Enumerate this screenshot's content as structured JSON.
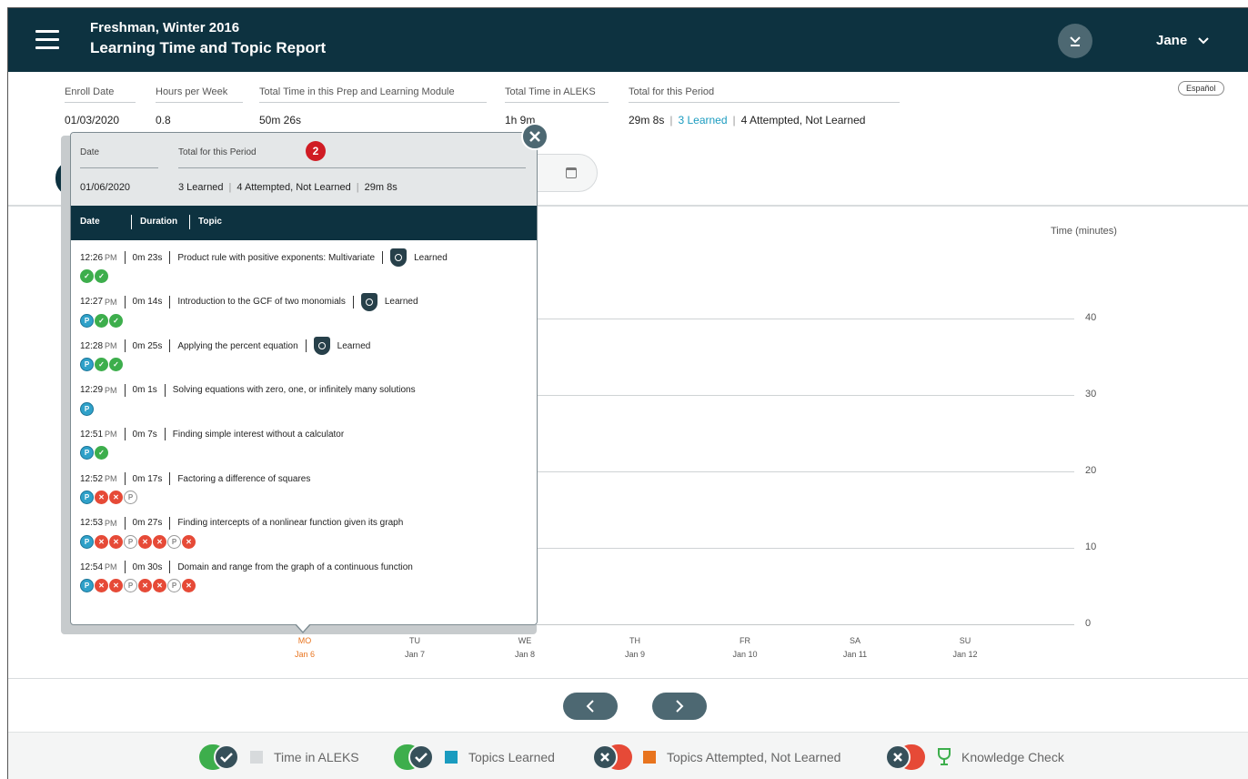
{
  "header": {
    "subtitle": "Freshman, Winter 2016",
    "title": "Learning Time and Topic Report",
    "user": "Jane"
  },
  "summary": {
    "enroll_date_label": "Enroll Date",
    "enroll_date": "01/03/2020",
    "hours_label": "Hours per Week",
    "hours": "0.8",
    "total_prep_label": "Total Time in this Prep and Learning Module",
    "total_prep": "50m 26s",
    "total_aleks_label": "Total Time in ALEKS",
    "total_aleks": "1h 9m",
    "period_label": "Total for this Period",
    "period_time": "29m 8s",
    "period_learned": "3 Learned",
    "period_attempted": "4 Attempted, Not Learned",
    "espanol": "Español"
  },
  "popup": {
    "date_label": "Date",
    "total_label": "Total for this Period",
    "badge": "2",
    "date": "01/06/2020",
    "learned": "3 Learned",
    "attempted": "4 Attempted, Not Learned",
    "time": "29m 8s",
    "col_date": "Date",
    "col_duration": "Duration",
    "col_topic": "Topic",
    "rows": [
      {
        "time": "12:26",
        "ampm": "PM",
        "duration": "0m 23s",
        "topic": "Product rule with positive exponents: Multivariate",
        "status": "Learned",
        "icons": [
          "ok",
          "ok"
        ]
      },
      {
        "time": "12:27",
        "ampm": "PM",
        "duration": "0m 14s",
        "topic": "Introduction to the GCF of two monomials",
        "status": "Learned",
        "icons": [
          "p",
          "ok",
          "ok"
        ]
      },
      {
        "time": "12:28",
        "ampm": "PM",
        "duration": "0m 25s",
        "topic": "Applying the percent equation",
        "status": "Learned",
        "icons": [
          "p",
          "ok",
          "ok"
        ]
      },
      {
        "time": "12:29",
        "ampm": "PM",
        "duration": "0m 1s",
        "topic": "Solving equations with zero, one, or infinitely many solutions",
        "status": "",
        "icons": [
          "p"
        ]
      },
      {
        "time": "12:51",
        "ampm": "PM",
        "duration": "0m 7s",
        "topic": "Finding simple interest without a calculator",
        "status": "",
        "icons": [
          "p",
          "ok"
        ]
      },
      {
        "time": "12:52",
        "ampm": "PM",
        "duration": "0m 17s",
        "topic": "Factoring a difference of squares",
        "status": "",
        "icons": [
          "p",
          "x",
          "x",
          "pg"
        ]
      },
      {
        "time": "12:53",
        "ampm": "PM",
        "duration": "0m 27s",
        "topic": "Finding intercepts of a nonlinear function given its graph",
        "status": "",
        "icons": [
          "p",
          "x",
          "x",
          "pg",
          "x",
          "x",
          "pg",
          "x"
        ]
      },
      {
        "time": "12:54",
        "ampm": "PM",
        "duration": "0m 30s",
        "topic": "Domain and range from the graph of a continuous function",
        "status": "",
        "icons": [
          "p",
          "x",
          "x",
          "pg",
          "x",
          "x",
          "pg",
          "x"
        ]
      }
    ]
  },
  "chart": {
    "ylabel": "Time (minutes)",
    "ticks": [
      "40",
      "30",
      "20",
      "10",
      "0"
    ],
    "days": [
      {
        "dow": "MO",
        "date": "Jan 6",
        "active": true
      },
      {
        "dow": "TU",
        "date": "Jan 7"
      },
      {
        "dow": "WE",
        "date": "Jan 8"
      },
      {
        "dow": "TH",
        "date": "Jan 9"
      },
      {
        "dow": "FR",
        "date": "Jan 10"
      },
      {
        "dow": "SA",
        "date": "Jan 11"
      },
      {
        "dow": "SU",
        "date": "Jan 12"
      }
    ]
  },
  "legend": {
    "time": "Time in ALEKS",
    "learned": "Topics Learned",
    "attempted": "Topics Attempted, Not Learned",
    "knowledge": "Knowledge Check"
  },
  "colors": {
    "header": "#0d3240",
    "learned": "#1a9bbf",
    "attempted": "#e8741e",
    "check": "#3dae4c",
    "error": "#e64a37"
  }
}
